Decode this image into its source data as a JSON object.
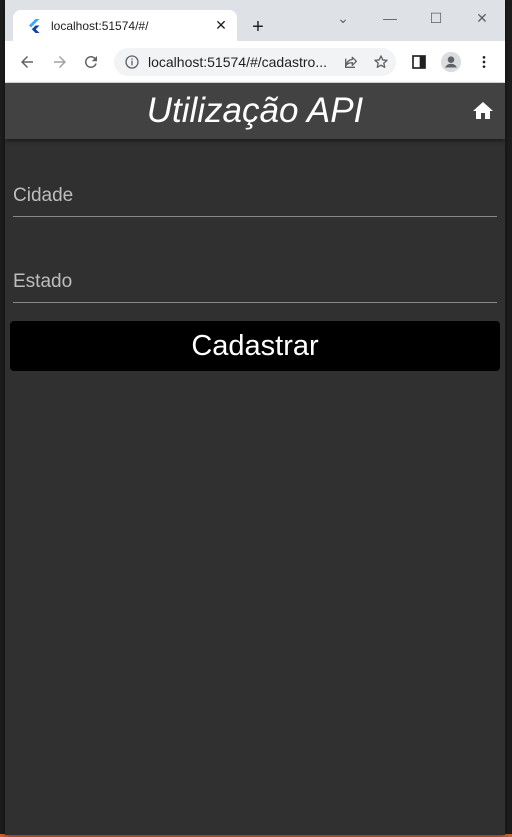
{
  "browser": {
    "tab_title": "localhost:51574/#/",
    "tab_close": "✕",
    "new_tab": "+",
    "url": "localhost:51574/#/cadastro...",
    "window_controls": {
      "minimize": "—",
      "maximize": "☐",
      "close": "✕",
      "dropdown": "⌄"
    }
  },
  "app": {
    "title": "Utilização API",
    "fields": [
      {
        "label": "Cidade",
        "value": ""
      },
      {
        "label": "Estado",
        "value": ""
      }
    ],
    "submit_label": "Cadastrar"
  },
  "colors": {
    "app_background": "#303030",
    "appbar": "#424242",
    "button": "#000000",
    "browser_frame": "#dee1e6"
  },
  "icons": [
    "flutter-favicon",
    "back-arrow-icon",
    "forward-arrow-icon",
    "reload-icon",
    "info-icon",
    "share-icon",
    "star-icon",
    "sidebar-icon",
    "profile-icon",
    "menu-icon",
    "home-icon"
  ]
}
